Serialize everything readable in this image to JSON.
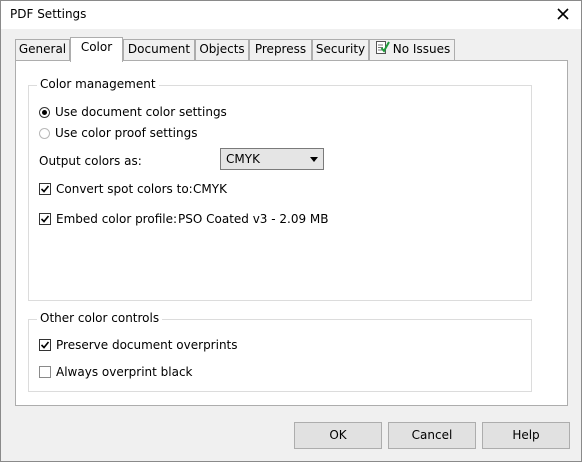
{
  "window": {
    "title": "PDF Settings"
  },
  "tabs": [
    {
      "label": "General"
    },
    {
      "label": "Color",
      "active": true
    },
    {
      "label": "Document"
    },
    {
      "label": "Objects"
    },
    {
      "label": "Prepress"
    },
    {
      "label": "Security"
    },
    {
      "label": "No Issues",
      "icon": "document-check-icon"
    }
  ],
  "color_management": {
    "title": "Color management",
    "radio_document": "Use document color settings",
    "radio_proof": "Use color proof settings",
    "selected": "document",
    "output_label": "Output colors as:",
    "output_value": "CMYK",
    "convert_spot_label": "Convert spot colors to:",
    "convert_spot_value": "CMYK",
    "convert_spot_checked": true,
    "embed_profile_label": "Embed color profile:",
    "embed_profile_value": "PSO Coated v3 - 2.09 MB",
    "embed_profile_checked": true
  },
  "other_controls": {
    "title": "Other color controls",
    "preserve_label": "Preserve document overprints",
    "preserve_checked": true,
    "overprint_black_label": "Always overprint black",
    "overprint_black_checked": false
  },
  "buttons": {
    "ok": "OK",
    "cancel": "Cancel",
    "help": "Help"
  },
  "colors": {
    "check_icon_accent": "#1e9a3a"
  }
}
